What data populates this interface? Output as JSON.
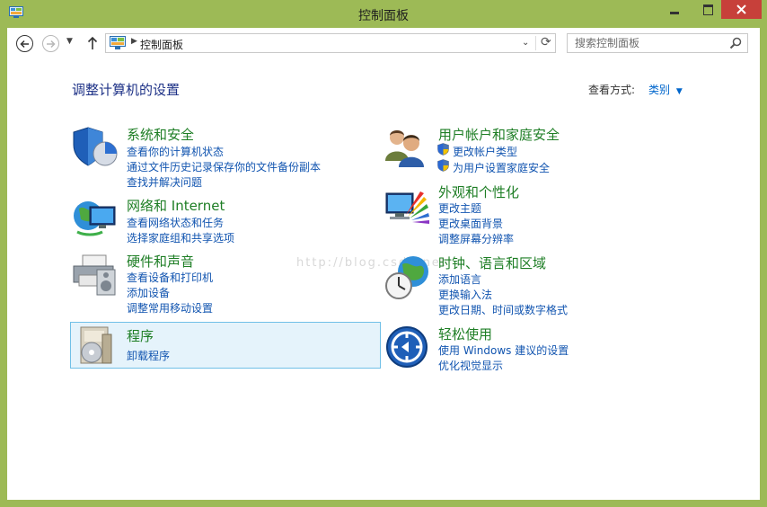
{
  "window": {
    "title": "控制面板"
  },
  "nav": {
    "address": "控制面板",
    "search_placeholder": "搜索控制面板"
  },
  "main": {
    "heading": "调整计算机的设置",
    "view_by_label": "查看方式:",
    "view_by_value": "类别"
  },
  "watermark": "http://blog.csdn.net",
  "categories": [
    {
      "title": "系统和安全",
      "links": [
        "查看你的计算机状态",
        "通过文件历史记录保存你的文件备份副本",
        "查找并解决问题"
      ]
    },
    {
      "title": "网络和 Internet",
      "links": [
        "查看网络状态和任务",
        "选择家庭组和共享选项"
      ]
    },
    {
      "title": "硬件和声音",
      "links": [
        "查看设备和打印机",
        "添加设备",
        "调整常用移动设置"
      ]
    },
    {
      "title": "程序",
      "links": [
        "卸载程序"
      ]
    },
    {
      "title": "用户帐户和家庭安全",
      "links": [
        "更改帐户类型",
        "为用户设置家庭安全"
      ]
    },
    {
      "title": "外观和个性化",
      "links": [
        "更改主题",
        "更改桌面背景",
        "调整屏幕分辨率"
      ]
    },
    {
      "title": "时钟、语言和区域",
      "links": [
        "添加语言",
        "更换输入法",
        "更改日期、时间或数字格式"
      ]
    },
    {
      "title": "轻松使用",
      "links": [
        "使用 Windows 建议的设置",
        "优化视觉显示"
      ]
    }
  ],
  "colors": {
    "frame": "#9dba56",
    "close": "#c7403a",
    "heading": "#1e3287",
    "category_title": "#1e7e25",
    "link": "#1255b0",
    "selected_bg": "#e5f3fb",
    "selected_border": "#70c0e7"
  },
  "icons": {
    "app": "control-panel-icon",
    "back": "back-arrow-icon",
    "forward": "forward-arrow-icon",
    "up": "up-arrow-icon",
    "refresh": "refresh-icon",
    "search": "search-icon"
  }
}
